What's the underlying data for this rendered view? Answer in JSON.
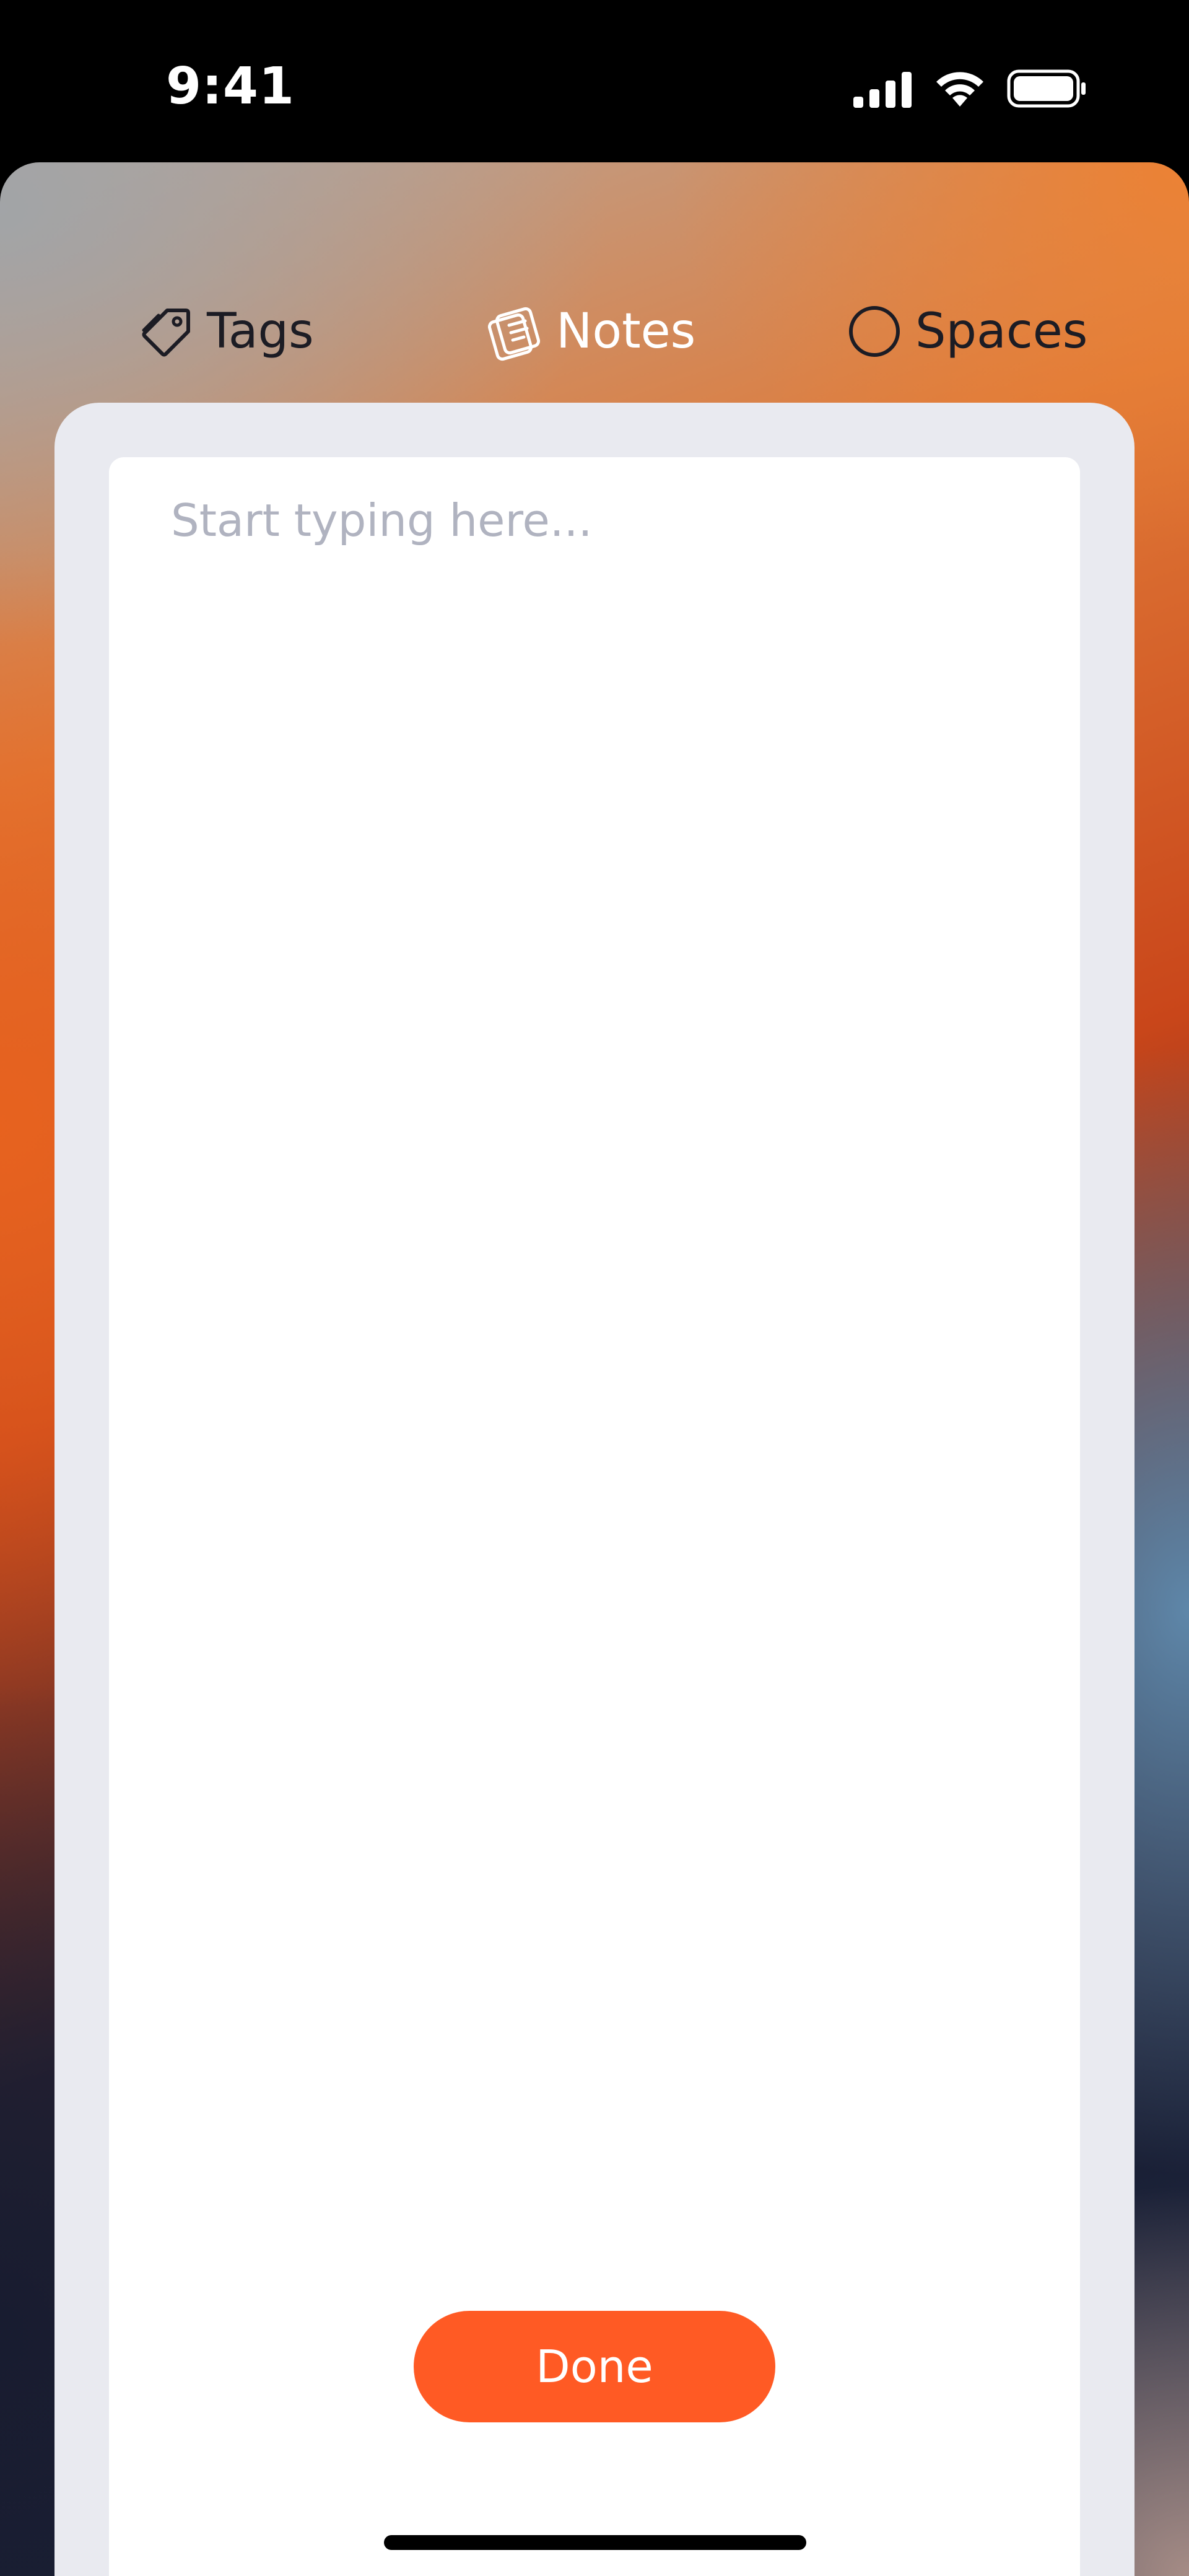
{
  "status_bar": {
    "time": "9:41"
  },
  "tabs": [
    {
      "id": "tags",
      "label": "Tags",
      "icon": "tag-icon",
      "active": false
    },
    {
      "id": "notes",
      "label": "Notes",
      "icon": "notes-icon",
      "active": true
    },
    {
      "id": "spaces",
      "label": "Spaces",
      "icon": "circle-icon",
      "active": false
    }
  ],
  "note": {
    "value": "",
    "placeholder": "Start typing here..."
  },
  "actions": {
    "done_label": "Done"
  },
  "colors": {
    "accent": "#ff5a24",
    "card_outer": "#e9eaf0",
    "card_inner": "#ffffff",
    "placeholder": "#b0b3c0",
    "tab_dark": "#1c1c24",
    "tab_active": "#ffffff"
  }
}
